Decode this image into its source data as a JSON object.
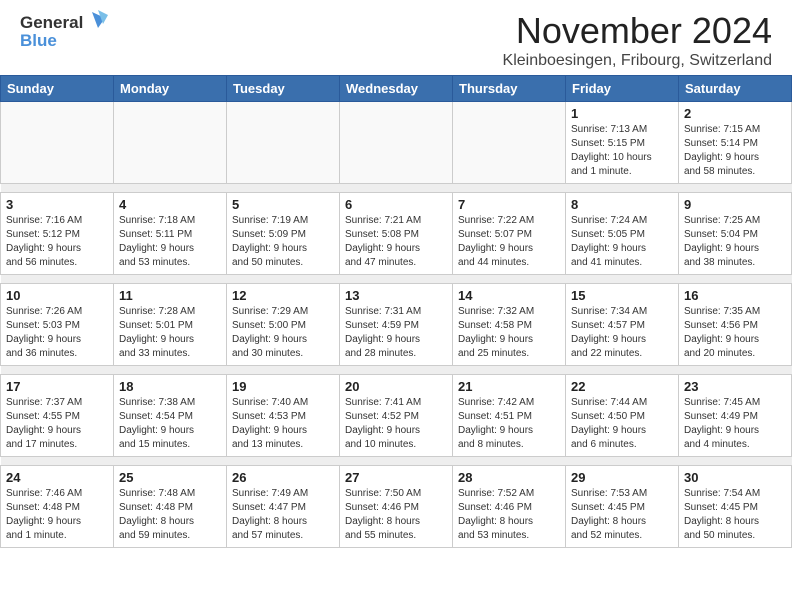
{
  "header": {
    "logo_general": "General",
    "logo_blue": "Blue",
    "month": "November 2024",
    "location": "Kleinboesingen, Fribourg, Switzerland"
  },
  "days_of_week": [
    "Sunday",
    "Monday",
    "Tuesday",
    "Wednesday",
    "Thursday",
    "Friday",
    "Saturday"
  ],
  "weeks": [
    [
      {
        "day": "",
        "info": ""
      },
      {
        "day": "",
        "info": ""
      },
      {
        "day": "",
        "info": ""
      },
      {
        "day": "",
        "info": ""
      },
      {
        "day": "",
        "info": ""
      },
      {
        "day": "1",
        "info": "Sunrise: 7:13 AM\nSunset: 5:15 PM\nDaylight: 10 hours\nand 1 minute."
      },
      {
        "day": "2",
        "info": "Sunrise: 7:15 AM\nSunset: 5:14 PM\nDaylight: 9 hours\nand 58 minutes."
      }
    ],
    [
      {
        "day": "3",
        "info": "Sunrise: 7:16 AM\nSunset: 5:12 PM\nDaylight: 9 hours\nand 56 minutes."
      },
      {
        "day": "4",
        "info": "Sunrise: 7:18 AM\nSunset: 5:11 PM\nDaylight: 9 hours\nand 53 minutes."
      },
      {
        "day": "5",
        "info": "Sunrise: 7:19 AM\nSunset: 5:09 PM\nDaylight: 9 hours\nand 50 minutes."
      },
      {
        "day": "6",
        "info": "Sunrise: 7:21 AM\nSunset: 5:08 PM\nDaylight: 9 hours\nand 47 minutes."
      },
      {
        "day": "7",
        "info": "Sunrise: 7:22 AM\nSunset: 5:07 PM\nDaylight: 9 hours\nand 44 minutes."
      },
      {
        "day": "8",
        "info": "Sunrise: 7:24 AM\nSunset: 5:05 PM\nDaylight: 9 hours\nand 41 minutes."
      },
      {
        "day": "9",
        "info": "Sunrise: 7:25 AM\nSunset: 5:04 PM\nDaylight: 9 hours\nand 38 minutes."
      }
    ],
    [
      {
        "day": "10",
        "info": "Sunrise: 7:26 AM\nSunset: 5:03 PM\nDaylight: 9 hours\nand 36 minutes."
      },
      {
        "day": "11",
        "info": "Sunrise: 7:28 AM\nSunset: 5:01 PM\nDaylight: 9 hours\nand 33 minutes."
      },
      {
        "day": "12",
        "info": "Sunrise: 7:29 AM\nSunset: 5:00 PM\nDaylight: 9 hours\nand 30 minutes."
      },
      {
        "day": "13",
        "info": "Sunrise: 7:31 AM\nSunset: 4:59 PM\nDaylight: 9 hours\nand 28 minutes."
      },
      {
        "day": "14",
        "info": "Sunrise: 7:32 AM\nSunset: 4:58 PM\nDaylight: 9 hours\nand 25 minutes."
      },
      {
        "day": "15",
        "info": "Sunrise: 7:34 AM\nSunset: 4:57 PM\nDaylight: 9 hours\nand 22 minutes."
      },
      {
        "day": "16",
        "info": "Sunrise: 7:35 AM\nSunset: 4:56 PM\nDaylight: 9 hours\nand 20 minutes."
      }
    ],
    [
      {
        "day": "17",
        "info": "Sunrise: 7:37 AM\nSunset: 4:55 PM\nDaylight: 9 hours\nand 17 minutes."
      },
      {
        "day": "18",
        "info": "Sunrise: 7:38 AM\nSunset: 4:54 PM\nDaylight: 9 hours\nand 15 minutes."
      },
      {
        "day": "19",
        "info": "Sunrise: 7:40 AM\nSunset: 4:53 PM\nDaylight: 9 hours\nand 13 minutes."
      },
      {
        "day": "20",
        "info": "Sunrise: 7:41 AM\nSunset: 4:52 PM\nDaylight: 9 hours\nand 10 minutes."
      },
      {
        "day": "21",
        "info": "Sunrise: 7:42 AM\nSunset: 4:51 PM\nDaylight: 9 hours\nand 8 minutes."
      },
      {
        "day": "22",
        "info": "Sunrise: 7:44 AM\nSunset: 4:50 PM\nDaylight: 9 hours\nand 6 minutes."
      },
      {
        "day": "23",
        "info": "Sunrise: 7:45 AM\nSunset: 4:49 PM\nDaylight: 9 hours\nand 4 minutes."
      }
    ],
    [
      {
        "day": "24",
        "info": "Sunrise: 7:46 AM\nSunset: 4:48 PM\nDaylight: 9 hours\nand 1 minute."
      },
      {
        "day": "25",
        "info": "Sunrise: 7:48 AM\nSunset: 4:48 PM\nDaylight: 8 hours\nand 59 minutes."
      },
      {
        "day": "26",
        "info": "Sunrise: 7:49 AM\nSunset: 4:47 PM\nDaylight: 8 hours\nand 57 minutes."
      },
      {
        "day": "27",
        "info": "Sunrise: 7:50 AM\nSunset: 4:46 PM\nDaylight: 8 hours\nand 55 minutes."
      },
      {
        "day": "28",
        "info": "Sunrise: 7:52 AM\nSunset: 4:46 PM\nDaylight: 8 hours\nand 53 minutes."
      },
      {
        "day": "29",
        "info": "Sunrise: 7:53 AM\nSunset: 4:45 PM\nDaylight: 8 hours\nand 52 minutes."
      },
      {
        "day": "30",
        "info": "Sunrise: 7:54 AM\nSunset: 4:45 PM\nDaylight: 8 hours\nand 50 minutes."
      }
    ]
  ]
}
